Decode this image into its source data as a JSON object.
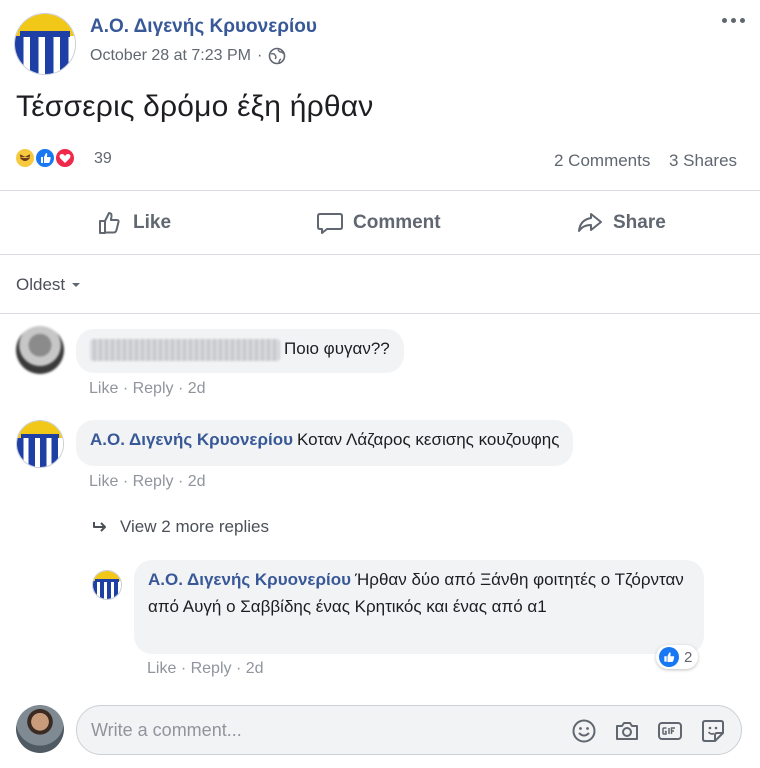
{
  "post": {
    "author": "Α.Ο. Διγενής Κρυονερίου",
    "timestamp": "October 28 at 7:23 PM",
    "audience_icon": "globe-icon",
    "text": "Τέσσερις δρόμο έξη ήρθαν",
    "reaction_count": "39",
    "comments_count": "2 Comments",
    "shares_count": "3 Shares"
  },
  "actions": {
    "like": "Like",
    "comment": "Comment",
    "share": "Share"
  },
  "filter": {
    "label": "Oldest"
  },
  "comments": [
    {
      "author": "",
      "text": "Ποιο φυγαν??",
      "like": "Like",
      "reply": "Reply",
      "age": "2d"
    },
    {
      "author": "Α.Ο. Διγενής Κρυονερίου",
      "text": "Κοταν Λάζαρος κεσισης κουζουφης",
      "like": "Like",
      "reply": "Reply",
      "age": "2d"
    }
  ],
  "view_more_replies": "View 2 more replies",
  "reply": {
    "author": "Α.Ο. Διγενής Κρυονερίου",
    "text": "Ήρθαν δύο από Ξάνθη φοιτητές ο Τζόρνταν από Αυγή ο Σαββίδης ένας Κρητικός και ένας από α1",
    "like": "Like",
    "reply": "Reply",
    "age": "2d",
    "like_count": "2"
  },
  "composer": {
    "placeholder": "Write a comment..."
  },
  "colors": {
    "link": "#385898",
    "brand": "#1877f2",
    "crest_blue": "#1d3fa6",
    "crest_yellow": "#f1c817"
  }
}
